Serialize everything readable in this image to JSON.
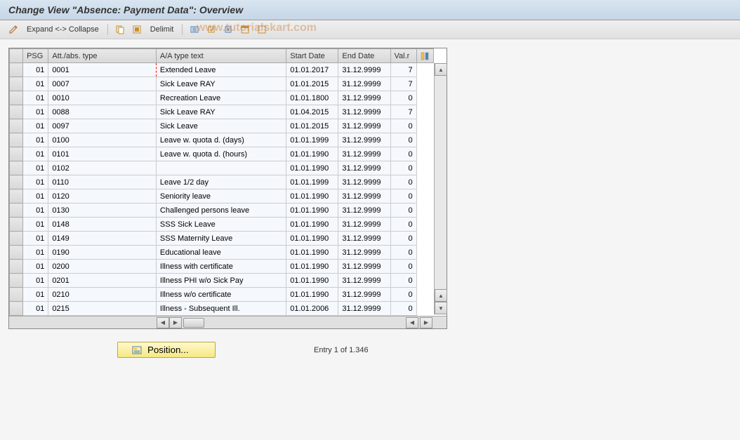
{
  "header": {
    "title": "Change View \"Absence: Payment Data\": Overview"
  },
  "toolbar": {
    "expand_collapse": "Expand <-> Collapse",
    "delimit": "Delimit"
  },
  "watermark": "www.tutorialskart.com",
  "table": {
    "columns": {
      "psg": "PSG",
      "att_abs_type": "Att./abs. type",
      "aa_type_text": "A/A type text",
      "start_date": "Start Date",
      "end_date": "End Date",
      "val_r": "Val.r"
    },
    "rows": [
      {
        "psg": "01",
        "type": "0001",
        "text": "Extended Leave",
        "start": "01.01.2017",
        "end": "31.12.9999",
        "val": "7",
        "highlighted": true
      },
      {
        "psg": "01",
        "type": "0007",
        "text": "Sick Leave RAY",
        "start": "01.01.2015",
        "end": "31.12.9999",
        "val": "7"
      },
      {
        "psg": "01",
        "type": "0010",
        "text": "Recreation Leave",
        "start": "01.01.1800",
        "end": "31.12.9999",
        "val": "0"
      },
      {
        "psg": "01",
        "type": "0088",
        "text": "Sick Leave RAY",
        "start": "01.04.2015",
        "end": "31.12.9999",
        "val": "7"
      },
      {
        "psg": "01",
        "type": "0097",
        "text": "Sick Leave",
        "start": "01.01.2015",
        "end": "31.12.9999",
        "val": "0"
      },
      {
        "psg": "01",
        "type": "0100",
        "text": "Leave w. quota d. (days)",
        "start": "01.01.1999",
        "end": "31.12.9999",
        "val": "0"
      },
      {
        "psg": "01",
        "type": "0101",
        "text": "Leave w. quota d. (hours)",
        "start": "01.01.1990",
        "end": "31.12.9999",
        "val": "0"
      },
      {
        "psg": "01",
        "type": "0102",
        "text": "",
        "start": "01.01.1990",
        "end": "31.12.9999",
        "val": "0"
      },
      {
        "psg": "01",
        "type": "0110",
        "text": "Leave 1/2 day",
        "start": "01.01.1999",
        "end": "31.12.9999",
        "val": "0"
      },
      {
        "psg": "01",
        "type": "0120",
        "text": "Seniority leave",
        "start": "01.01.1990",
        "end": "31.12.9999",
        "val": "0"
      },
      {
        "psg": "01",
        "type": "0130",
        "text": "Challenged persons leave",
        "start": "01.01.1990",
        "end": "31.12.9999",
        "val": "0"
      },
      {
        "psg": "01",
        "type": "0148",
        "text": "SSS Sick Leave",
        "start": "01.01.1990",
        "end": "31.12.9999",
        "val": "0"
      },
      {
        "psg": "01",
        "type": "0149",
        "text": "SSS Maternity Leave",
        "start": "01.01.1990",
        "end": "31.12.9999",
        "val": "0"
      },
      {
        "psg": "01",
        "type": "0190",
        "text": "Educational leave",
        "start": "01.01.1990",
        "end": "31.12.9999",
        "val": "0"
      },
      {
        "psg": "01",
        "type": "0200",
        "text": "Illness with certificate",
        "start": "01.01.1990",
        "end": "31.12.9999",
        "val": "0"
      },
      {
        "psg": "01",
        "type": "0201",
        "text": "Illness PHI w/o Sick Pay",
        "start": "01.01.1990",
        "end": "31.12.9999",
        "val": "0"
      },
      {
        "psg": "01",
        "type": "0210",
        "text": "Illness w/o certificate",
        "start": "01.01.1990",
        "end": "31.12.9999",
        "val": "0"
      },
      {
        "psg": "01",
        "type": "0215",
        "text": "Illness - Subsequent Ill.",
        "start": "01.01.2006",
        "end": "31.12.9999",
        "val": "0"
      }
    ]
  },
  "footer": {
    "position_button": "Position...",
    "entry_text": "Entry 1 of 1.346"
  }
}
